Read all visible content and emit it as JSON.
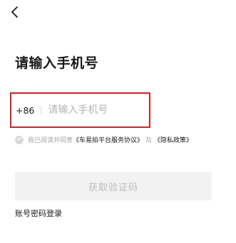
{
  "nav": {
    "back_icon": "chevron-left-icon"
  },
  "header": {
    "title": "请输入手机号"
  },
  "phone": {
    "country_code": "+86",
    "value": "",
    "placeholder": "请输入手机号",
    "highlight_color": "#d81e26"
  },
  "agreement": {
    "check_icon": "check-circle-icon",
    "checked": false,
    "prefix": "我已阅读并同意",
    "service_link": "《车易拍平台服务协议》",
    "separator": "及",
    "privacy_link": "《隐私政策》"
  },
  "actions": {
    "get_code_label": "获取验证码",
    "get_code_enabled": false,
    "password_login_label": "账号密码登录"
  }
}
